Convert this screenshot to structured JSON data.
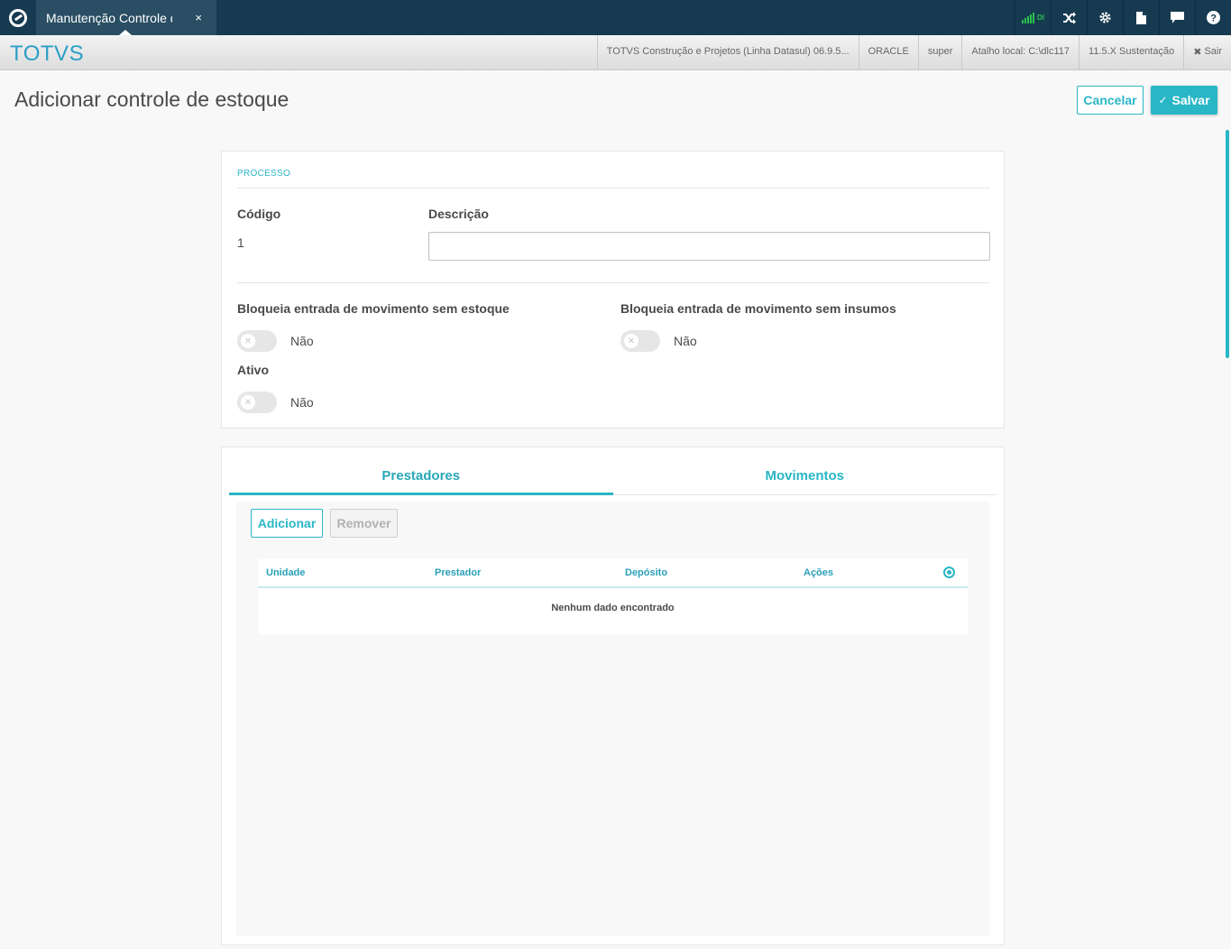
{
  "topbar": {
    "tab_label": "Manutenção Controle de Estoque",
    "tab_close": "×",
    "signal_label": "DI"
  },
  "header": {
    "brand": "TOTVS",
    "info": [
      "TOTVS Construção e Projetos (Linha Datasul) 06.9.5...",
      "ORACLE",
      "super",
      "Atalho local: C:\\dlc117",
      "11.5.X Sustentação",
      "Sair"
    ],
    "sair_icon": "✖"
  },
  "page": {
    "title": "Adicionar controle de estoque",
    "cancel_label": "Cancelar",
    "save_label": "Salvar"
  },
  "processo": {
    "section_title": "PROCESSO",
    "codigo_label": "Código",
    "codigo_value": "1",
    "descricao_label": "Descrição",
    "descricao_value": "",
    "bloqueia_estoque_label": "Bloqueia entrada de movimento sem estoque",
    "bloqueia_estoque_value": "Não",
    "bloqueia_insumos_label": "Bloqueia entrada de movimento sem insumos",
    "bloqueia_insumos_value": "Não",
    "ativo_label": "Ativo",
    "ativo_value": "Não"
  },
  "tabs": [
    {
      "label": "Prestadores",
      "active": true
    },
    {
      "label": "Movimentos",
      "active": false
    }
  ],
  "prestadores": {
    "add_label": "Adicionar",
    "remove_label": "Remover",
    "columns": [
      "Unidade",
      "Prestador",
      "Depósito",
      "Ações"
    ],
    "empty_message": "Nenhum dado encontrado"
  },
  "colors": {
    "accent": "#29b6c5",
    "topbar": "#163a50",
    "brand": "#2b9ec7"
  }
}
